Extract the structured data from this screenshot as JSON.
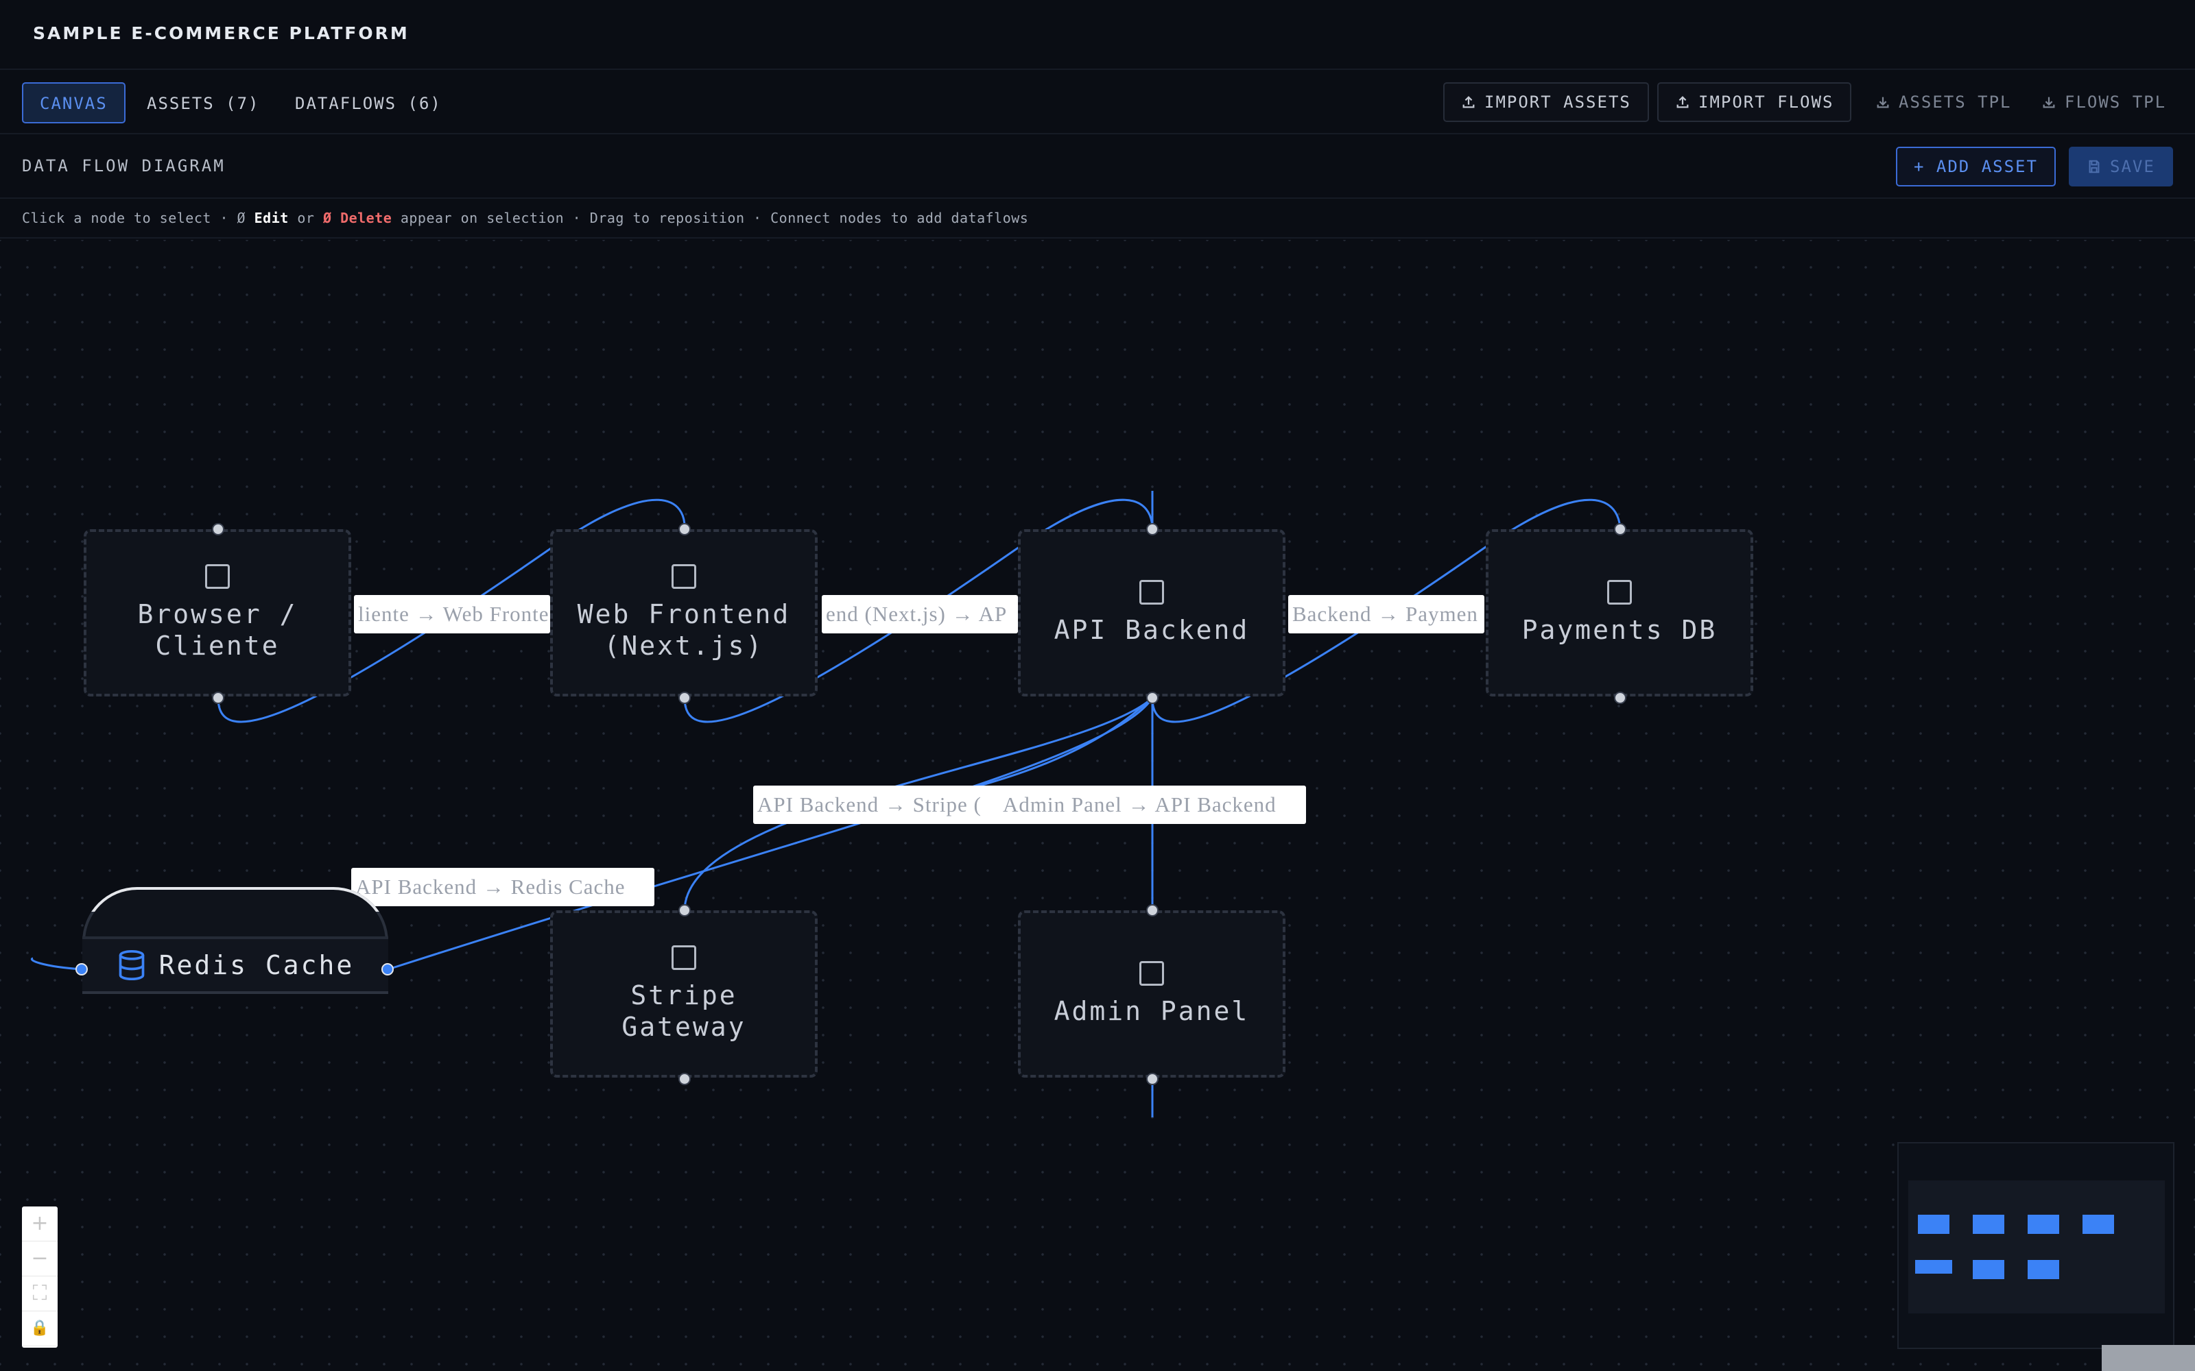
{
  "app": {
    "title": "SAMPLE E-COMMERCE PLATFORM"
  },
  "tabs": [
    {
      "label": "CANVAS",
      "active": true
    },
    {
      "label": "ASSETS (7)",
      "active": false
    },
    {
      "label": "DATAFLOWS (6)",
      "active": false
    }
  ],
  "toolbar": {
    "import_assets": "IMPORT ASSETS",
    "import_flows": "IMPORT FLOWS",
    "assets_tpl": "ASSETS TPL",
    "flows_tpl": "FLOWS TPL"
  },
  "header": {
    "title": "DATA FLOW DIAGRAM",
    "add_asset": "+ ADD ASSET",
    "save": "SAVE"
  },
  "help": {
    "part1": "Click a node to select · ",
    "edit_icon": "Ø",
    "edit": "Edit",
    "or": " or ",
    "delete_icon": "Ø",
    "delete": "Delete",
    "part2": " appear on selection · Drag to reposition · Connect nodes to add dataflows"
  },
  "nodes": {
    "browser": "Browser /\nCliente",
    "frontend": "Web Frontend\n(Next.js)",
    "api": "API Backend",
    "payments": "Payments DB",
    "stripe": "Stripe\nGateway",
    "admin": "Admin Panel",
    "redis": "Redis Cache"
  },
  "edge_labels": {
    "browser_frontend": "liente → Web Fronte",
    "frontend_api": "end (Next.js) → AP",
    "api_payments": "Backend → Paymen",
    "api_stripe": "API Backend → Stripe (",
    "admin_api": "Admin Panel → API Backend",
    "api_redis": "API Backend → Redis Cache"
  },
  "zoom": {
    "in": "+",
    "out": "−",
    "fit": "⛶",
    "lock": "🔒"
  },
  "colors": {
    "accent": "#3b82f6",
    "background": "#0a0d14",
    "node_border": "#2d3340"
  },
  "icons": [
    "upload-icon",
    "download-icon",
    "save-icon",
    "database-icon",
    "square-icon"
  ]
}
